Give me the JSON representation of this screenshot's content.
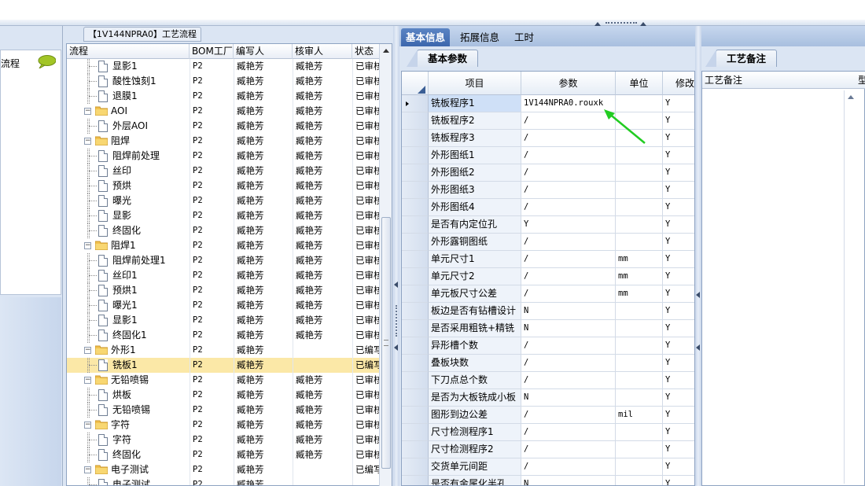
{
  "left_pane": {
    "flow_label": "流程"
  },
  "center": {
    "tab_title": "【1V144NPRA0】工艺流程",
    "columns": [
      "流程",
      "BOM工厂",
      "编写人",
      "核审人",
      "状态"
    ],
    "rows": [
      {
        "kind": "doc",
        "level": 2,
        "name": "显影1",
        "bom": "P2",
        "writer": "臧艳芳",
        "reviewer": "臧艳芳",
        "status": "已审核"
      },
      {
        "kind": "doc",
        "level": 2,
        "name": "酸性蚀刻1",
        "bom": "P2",
        "writer": "臧艳芳",
        "reviewer": "臧艳芳",
        "status": "已审核"
      },
      {
        "kind": "doc",
        "level": 2,
        "name": "退膜1",
        "bom": "P2",
        "writer": "臧艳芳",
        "reviewer": "臧艳芳",
        "status": "已审核"
      },
      {
        "kind": "folder",
        "level": 1,
        "name": "AOI",
        "bom": "P2",
        "writer": "臧艳芳",
        "reviewer": "臧艳芳",
        "status": "已审核"
      },
      {
        "kind": "doc",
        "level": 2,
        "name": "外层AOI",
        "bom": "P2",
        "writer": "臧艳芳",
        "reviewer": "臧艳芳",
        "status": "已审核"
      },
      {
        "kind": "folder",
        "level": 1,
        "name": "阻焊",
        "bom": "P2",
        "writer": "臧艳芳",
        "reviewer": "臧艳芳",
        "status": "已审核"
      },
      {
        "kind": "doc",
        "level": 2,
        "name": "阻焊前处理",
        "bom": "P2",
        "writer": "臧艳芳",
        "reviewer": "臧艳芳",
        "status": "已审核"
      },
      {
        "kind": "doc",
        "level": 2,
        "name": "丝印",
        "bom": "P2",
        "writer": "臧艳芳",
        "reviewer": "臧艳芳",
        "status": "已审核"
      },
      {
        "kind": "doc",
        "level": 2,
        "name": "预烘",
        "bom": "P2",
        "writer": "臧艳芳",
        "reviewer": "臧艳芳",
        "status": "已审核"
      },
      {
        "kind": "doc",
        "level": 2,
        "name": "曝光",
        "bom": "P2",
        "writer": "臧艳芳",
        "reviewer": "臧艳芳",
        "status": "已审核"
      },
      {
        "kind": "doc",
        "level": 2,
        "name": "显影",
        "bom": "P2",
        "writer": "臧艳芳",
        "reviewer": "臧艳芳",
        "status": "已审核"
      },
      {
        "kind": "doc",
        "level": 2,
        "name": "终固化",
        "bom": "P2",
        "writer": "臧艳芳",
        "reviewer": "臧艳芳",
        "status": "已审核"
      },
      {
        "kind": "folder",
        "level": 1,
        "name": "阻焊1",
        "bom": "P2",
        "writer": "臧艳芳",
        "reviewer": "臧艳芳",
        "status": "已审核"
      },
      {
        "kind": "doc",
        "level": 2,
        "name": "阻焊前处理1",
        "bom": "P2",
        "writer": "臧艳芳",
        "reviewer": "臧艳芳",
        "status": "已审核"
      },
      {
        "kind": "doc",
        "level": 2,
        "name": "丝印1",
        "bom": "P2",
        "writer": "臧艳芳",
        "reviewer": "臧艳芳",
        "status": "已审核"
      },
      {
        "kind": "doc",
        "level": 2,
        "name": "预烘1",
        "bom": "P2",
        "writer": "臧艳芳",
        "reviewer": "臧艳芳",
        "status": "已审核"
      },
      {
        "kind": "doc",
        "level": 2,
        "name": "曝光1",
        "bom": "P2",
        "writer": "臧艳芳",
        "reviewer": "臧艳芳",
        "status": "已审核"
      },
      {
        "kind": "doc",
        "level": 2,
        "name": "显影1",
        "bom": "P2",
        "writer": "臧艳芳",
        "reviewer": "臧艳芳",
        "status": "已审核"
      },
      {
        "kind": "doc",
        "level": 2,
        "name": "终固化1",
        "bom": "P2",
        "writer": "臧艳芳",
        "reviewer": "臧艳芳",
        "status": "已审核"
      },
      {
        "kind": "folder",
        "level": 1,
        "name": "外形1",
        "bom": "P2",
        "writer": "臧艳芳",
        "reviewer": "",
        "status": "已编写"
      },
      {
        "kind": "doc",
        "level": 2,
        "name": "铣板1",
        "bom": "P2",
        "writer": "臧艳芳",
        "reviewer": "",
        "status": "已编写",
        "selected": true
      },
      {
        "kind": "folder",
        "level": 1,
        "name": "无铅喷锡",
        "bom": "P2",
        "writer": "臧艳芳",
        "reviewer": "臧艳芳",
        "status": "已审核"
      },
      {
        "kind": "doc",
        "level": 2,
        "name": "烘板",
        "bom": "P2",
        "writer": "臧艳芳",
        "reviewer": "臧艳芳",
        "status": "已审核"
      },
      {
        "kind": "doc",
        "level": 2,
        "name": "无铅喷锡",
        "bom": "P2",
        "writer": "臧艳芳",
        "reviewer": "臧艳芳",
        "status": "已审核"
      },
      {
        "kind": "folder",
        "level": 1,
        "name": "字符",
        "bom": "P2",
        "writer": "臧艳芳",
        "reviewer": "臧艳芳",
        "status": "已审核"
      },
      {
        "kind": "doc",
        "level": 2,
        "name": "字符",
        "bom": "P2",
        "writer": "臧艳芳",
        "reviewer": "臧艳芳",
        "status": "已审核"
      },
      {
        "kind": "doc",
        "level": 2,
        "name": "终固化",
        "bom": "P2",
        "writer": "臧艳芳",
        "reviewer": "臧艳芳",
        "status": "已审核"
      },
      {
        "kind": "folder",
        "level": 1,
        "name": "电子测试",
        "bom": "P2",
        "writer": "臧艳芳",
        "reviewer": "",
        "status": "已编写"
      },
      {
        "kind": "doc",
        "level": 2,
        "name": "电子测试",
        "bom": "P2",
        "writer": "臧艳芳",
        "reviewer": "",
        "status": ""
      }
    ]
  },
  "right": {
    "tabs": [
      "基本信息",
      "拓展信息",
      "工时"
    ],
    "subtab_params": "基本参数",
    "subtab_notes": "工艺备注",
    "grid_columns": [
      "项目",
      "参数",
      "单位",
      "修改"
    ],
    "grid_rows": [
      {
        "item": "铣板程序1",
        "param": "1V144NPRA0.rouxk",
        "unit": "",
        "mod": "Y",
        "current": true
      },
      {
        "item": "铣板程序2",
        "param": "/",
        "unit": "",
        "mod": "Y"
      },
      {
        "item": "铣板程序3",
        "param": "/",
        "unit": "",
        "mod": "Y"
      },
      {
        "item": "外形图纸1",
        "param": "/",
        "unit": "",
        "mod": "Y"
      },
      {
        "item": "外形图纸2",
        "param": "/",
        "unit": "",
        "mod": "Y"
      },
      {
        "item": "外形图纸3",
        "param": "/",
        "unit": "",
        "mod": "Y"
      },
      {
        "item": "外形图纸4",
        "param": "/",
        "unit": "",
        "mod": "Y"
      },
      {
        "item": "是否有内定位孔",
        "param": "Y",
        "unit": "",
        "mod": "Y"
      },
      {
        "item": "外形露铜图纸",
        "param": "/",
        "unit": "",
        "mod": "Y"
      },
      {
        "item": "单元尺寸1",
        "param": "/",
        "unit": "mm",
        "mod": "Y"
      },
      {
        "item": "单元尺寸2",
        "param": "/",
        "unit": "mm",
        "mod": "Y"
      },
      {
        "item": "单元板尺寸公差",
        "param": "/",
        "unit": "mm",
        "mod": "Y"
      },
      {
        "item": "板边是否有钻槽设计",
        "param": "N",
        "unit": "",
        "mod": "Y"
      },
      {
        "item": "是否采用粗铣+精铣",
        "param": "N",
        "unit": "",
        "mod": "Y"
      },
      {
        "item": "异形槽个数",
        "param": "/",
        "unit": "",
        "mod": "Y"
      },
      {
        "item": "叠板块数",
        "param": "/",
        "unit": "",
        "mod": "Y"
      },
      {
        "item": "下刀点总个数",
        "param": "/",
        "unit": "",
        "mod": "Y"
      },
      {
        "item": "是否为大板铣成小板",
        "param": "N",
        "unit": "",
        "mod": "Y"
      },
      {
        "item": "图形到边公差",
        "param": "/",
        "unit": "mil",
        "mod": "Y"
      },
      {
        "item": "尺寸检测程序1",
        "param": "/",
        "unit": "",
        "mod": "Y"
      },
      {
        "item": "尺寸检测程序2",
        "param": "/",
        "unit": "",
        "mod": "Y"
      },
      {
        "item": "交货单元间距",
        "param": "/",
        "unit": "",
        "mod": "Y"
      },
      {
        "item": "是否有金属化半孔",
        "param": "N",
        "unit": "",
        "mod": "Y"
      }
    ],
    "notes_columns": [
      "工艺备注",
      "型"
    ]
  },
  "colors": {
    "selected_tree_row": "#fbe8a7",
    "active_tab": "#3c67ad",
    "arrow": "#22cc22"
  }
}
